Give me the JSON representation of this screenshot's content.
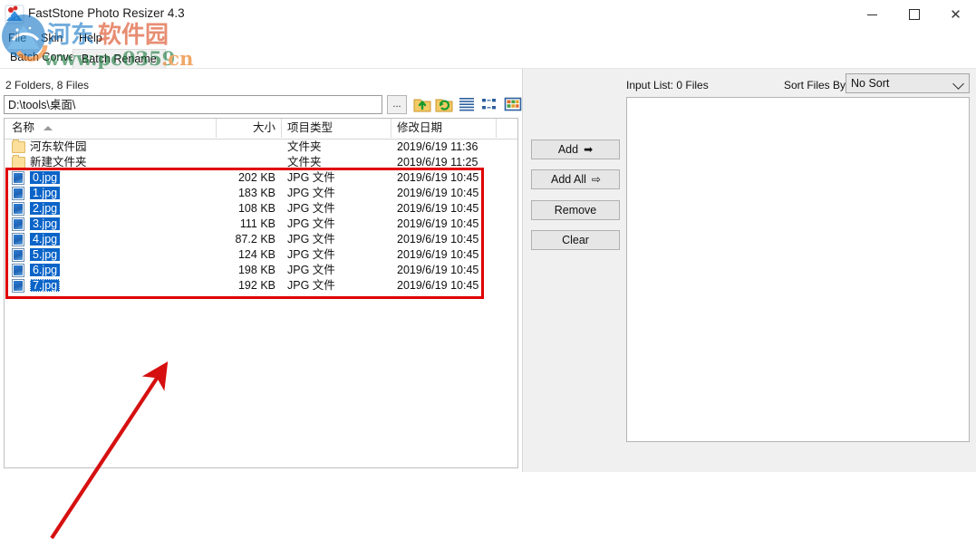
{
  "window": {
    "title": "FastStone Photo Resizer 4.3",
    "icon": "app-logo-icon",
    "minimize_label": "—",
    "maximize_label": "□",
    "close_label": "✕"
  },
  "menu": {
    "items": [
      {
        "label": "File",
        "name": "menu-file"
      },
      {
        "label": "Skin",
        "name": "menu-skin"
      },
      {
        "label": "Help",
        "name": "menu-help"
      }
    ]
  },
  "tabs": [
    {
      "label": "Batch Convert",
      "active": true
    },
    {
      "label": "Batch Rename",
      "active": false
    }
  ],
  "browser": {
    "status": "2 Folders, 8 Files",
    "path_value": "D:\\tools\\桌面\\",
    "browse_label": "...",
    "toolbar_icons": [
      "up-folder-icon",
      "refresh-folder-icon",
      "list-view-icon",
      "details-view-icon",
      "thumbnail-view-icon"
    ],
    "columns": [
      {
        "label": "名称",
        "key": "name"
      },
      {
        "label": "大小",
        "key": "size"
      },
      {
        "label": "项目类型",
        "key": "type"
      },
      {
        "label": "修改日期",
        "key": "date"
      }
    ],
    "sort_indicator": "ascending",
    "rows": [
      {
        "icon": "folder-icon",
        "name": "河东软件园",
        "size": "",
        "type": "文件夹",
        "date": "2019/6/19 11:36",
        "selected": false
      },
      {
        "icon": "folder-icon",
        "name": "新建文件夹",
        "size": "",
        "type": "文件夹",
        "date": "2019/6/19 11:25",
        "selected": false
      },
      {
        "icon": "jpg-file-icon",
        "name": "0.jpg",
        "size": "202 KB",
        "type": "JPG 文件",
        "date": "2019/6/19 10:45",
        "selected": true
      },
      {
        "icon": "jpg-file-icon",
        "name": "1.jpg",
        "size": "183 KB",
        "type": "JPG 文件",
        "date": "2019/6/19 10:45",
        "selected": true
      },
      {
        "icon": "jpg-file-icon",
        "name": "2.jpg",
        "size": "108 KB",
        "type": "JPG 文件",
        "date": "2019/6/19 10:45",
        "selected": true
      },
      {
        "icon": "jpg-file-icon",
        "name": "3.jpg",
        "size": "111 KB",
        "type": "JPG 文件",
        "date": "2019/6/19 10:45",
        "selected": true
      },
      {
        "icon": "jpg-file-icon",
        "name": "4.jpg",
        "size": "87.2 KB",
        "type": "JPG 文件",
        "date": "2019/6/19 10:45",
        "selected": true
      },
      {
        "icon": "jpg-file-icon",
        "name": "5.jpg",
        "size": "124 KB",
        "type": "JPG 文件",
        "date": "2019/6/19 10:45",
        "selected": true
      },
      {
        "icon": "jpg-file-icon",
        "name": "6.jpg",
        "size": "198 KB",
        "type": "JPG 文件",
        "date": "2019/6/19 10:45",
        "selected": true
      },
      {
        "icon": "jpg-file-icon",
        "name": "7.jpg",
        "size": "192 KB",
        "type": "JPG 文件",
        "date": "2019/6/19 10:45",
        "selected": true,
        "focused": true
      }
    ]
  },
  "actions": {
    "add": "Add",
    "add_arrow": "➡",
    "add_all": "Add All",
    "add_all_arrow": "⇨",
    "remove": "Remove",
    "clear": "Clear"
  },
  "input_list": {
    "label": "Input List:  0 Files",
    "sort_label": "Sort Files By:",
    "sort_value": "No Sort",
    "items": []
  },
  "annotation": {
    "highlight_color": "#e00000",
    "arrow_color": "#d61010",
    "note": "red-rectangle-around-selected-jpg-files"
  },
  "watermark": {
    "site_name": "河东软件园",
    "url": "www.pc0359.cn",
    "text_color": "#1b7a3e",
    "cn_color": "#e8720c"
  }
}
